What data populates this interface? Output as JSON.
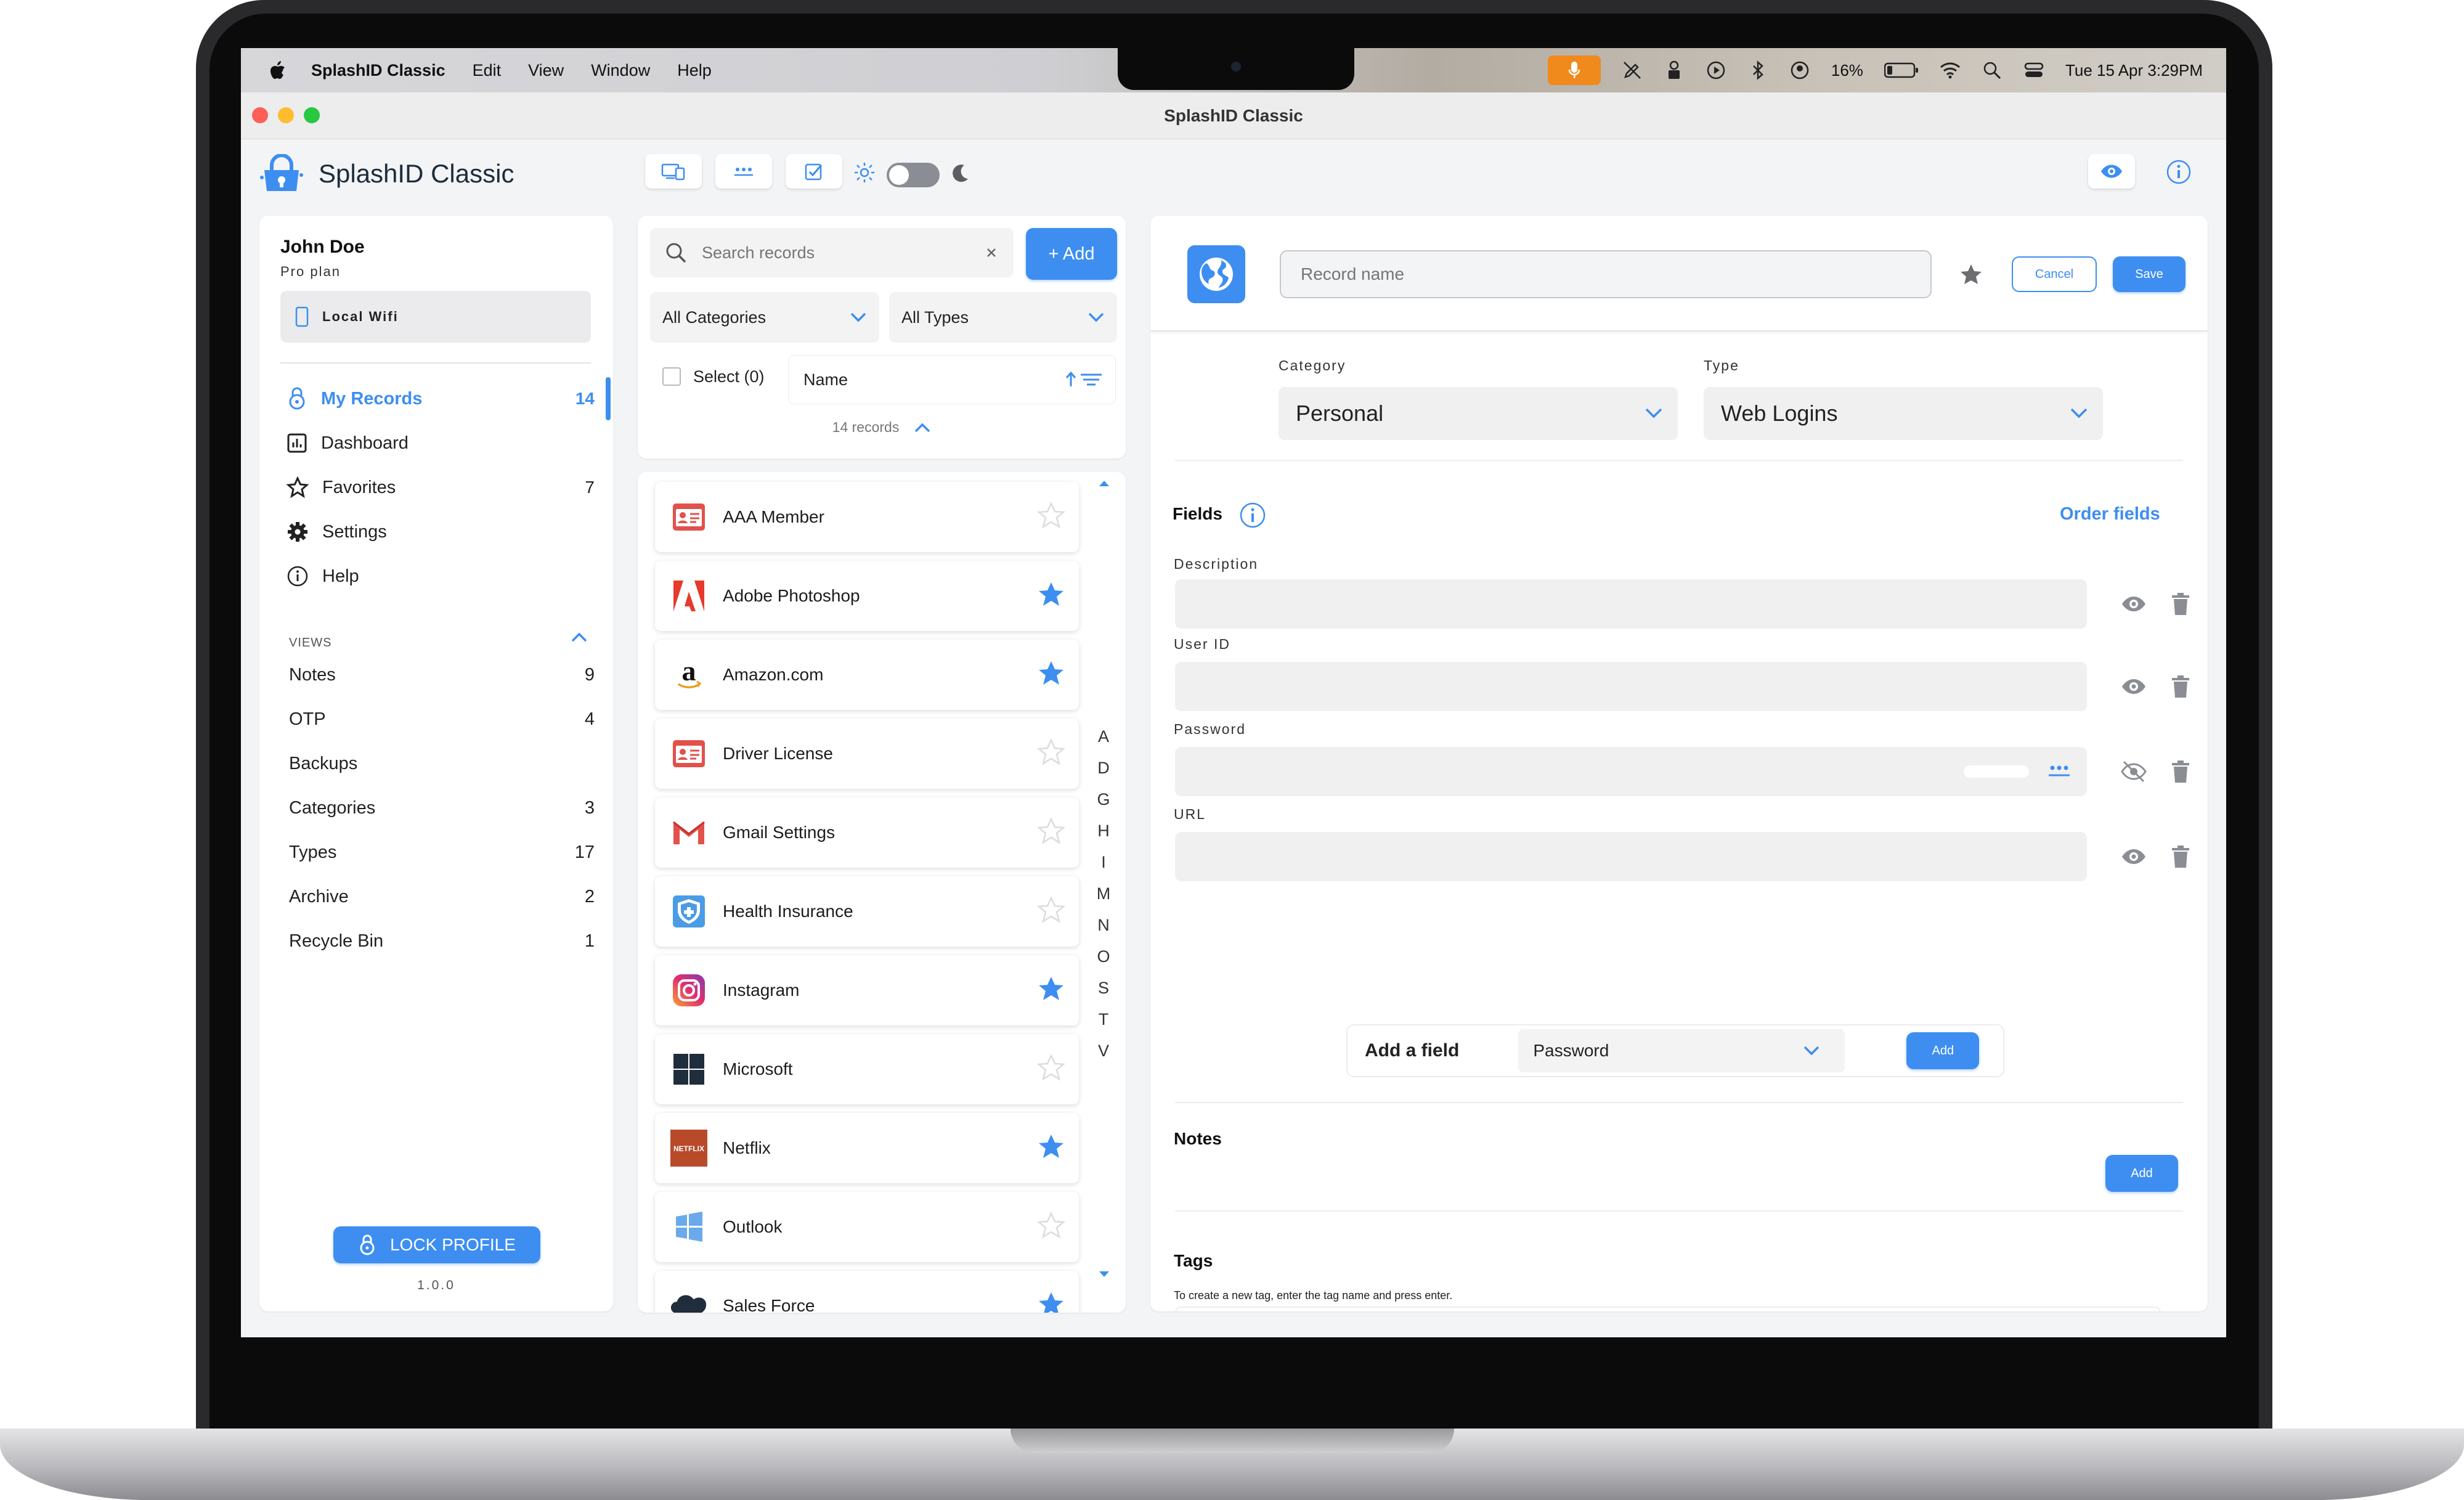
{
  "menubar": {
    "app_name": "SplashID Classic",
    "menus": [
      "Edit",
      "View",
      "Window",
      "Help"
    ],
    "battery": "16%",
    "datetime": "Tue 15 Apr  3:29PM"
  },
  "window": {
    "title": "SplashID Classic"
  },
  "header": {
    "app_title": "SplashID Classic",
    "toolbar_icons": [
      "devices-icon",
      "password-generator-icon",
      "checklist-icon",
      "sun-icon",
      "theme-toggle",
      "moon-icon"
    ],
    "right_icons": [
      "eye-icon",
      "info-icon"
    ]
  },
  "sidebar": {
    "user_name": "John Doe",
    "plan": "Pro plan",
    "sync_mode": "Local Wifi",
    "nav": [
      {
        "label": "My Records",
        "count": "14",
        "icon": "lock-icon",
        "active": true
      },
      {
        "label": "Dashboard",
        "count": "",
        "icon": "chart-icon"
      },
      {
        "label": "Favorites",
        "count": "7",
        "icon": "star-icon"
      },
      {
        "label": "Settings",
        "count": "",
        "icon": "gear-icon"
      },
      {
        "label": "Help",
        "count": "",
        "icon": "info-icon"
      }
    ],
    "views_heading": "VIEWS",
    "views": [
      {
        "label": "Notes",
        "count": "9"
      },
      {
        "label": "OTP",
        "count": "4"
      },
      {
        "label": "Backups",
        "count": ""
      },
      {
        "label": "Categories",
        "count": "3"
      },
      {
        "label": "Types",
        "count": "17"
      },
      {
        "label": "Archive",
        "count": "2"
      },
      {
        "label": "Recycle Bin",
        "count": "1"
      }
    ],
    "lock_button": "LOCK PROFILE",
    "version": "1.0.0"
  },
  "list": {
    "search_placeholder": "Search records",
    "add_button": "+ Add",
    "category_filter": "All Categories",
    "type_filter": "All Types",
    "select_label": "Select (0)",
    "sort_label": "Name",
    "records_count": "14 records",
    "records": [
      {
        "name": "AAA Member",
        "favorite": false,
        "icon": "id-card-icon"
      },
      {
        "name": "Adobe Photoshop",
        "favorite": true,
        "icon": "adobe-icon"
      },
      {
        "name": "Amazon.com",
        "favorite": true,
        "icon": "amazon-icon"
      },
      {
        "name": "Driver License",
        "favorite": false,
        "icon": "id-card-icon"
      },
      {
        "name": "Gmail Settings",
        "favorite": false,
        "icon": "gmail-icon"
      },
      {
        "name": "Health Insurance",
        "favorite": false,
        "icon": "shield-icon"
      },
      {
        "name": "Instagram",
        "favorite": true,
        "icon": "instagram-icon"
      },
      {
        "name": "Microsoft",
        "favorite": false,
        "icon": "microsoft-icon"
      },
      {
        "name": "Netflix",
        "favorite": true,
        "icon": "netflix-icon"
      },
      {
        "name": "Outlook",
        "favorite": false,
        "icon": "windows-icon"
      },
      {
        "name": "Sales Force",
        "favorite": true,
        "icon": "cloud-icon"
      }
    ],
    "alphabet": [
      "A",
      "D",
      "G",
      "H",
      "I",
      "M",
      "N",
      "O",
      "S",
      "T",
      "V"
    ],
    "netflix_logo_text": "NETFLIX"
  },
  "detail": {
    "record_name_placeholder": "Record name",
    "cancel_button": "Cancel",
    "save_button": "Save",
    "category_label": "Category",
    "category_value": "Personal",
    "type_label": "Type",
    "type_value": "Web Logins",
    "fields_heading": "Fields",
    "order_fields": "Order fields",
    "fields": [
      {
        "label": "Description",
        "value": ""
      },
      {
        "label": "User ID",
        "value": ""
      },
      {
        "label": "Password",
        "value": ""
      },
      {
        "label": "URL",
        "value": ""
      }
    ],
    "add_field_label": "Add a field",
    "add_field_type": "Password",
    "add_field_button": "Add",
    "notes_heading": "Notes",
    "notes_add_button": "Add",
    "tags_heading": "Tags",
    "tags_hint": "To create a new tag, enter the tag name and press enter."
  },
  "colors": {
    "accent": "#3d8ef0",
    "star_fav": "#3d8ef0",
    "star_empty": "#d7d7d9"
  }
}
